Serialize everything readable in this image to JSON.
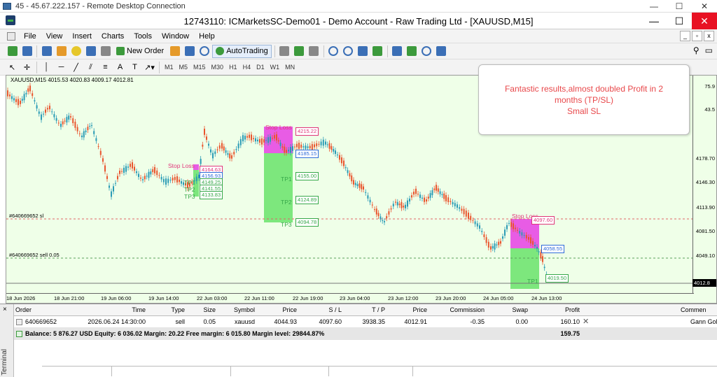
{
  "rdp": {
    "title": "45 - 45.67.222.157 - Remote Desktop Connection",
    "minimize": "—",
    "maximize": "☐",
    "close": "✕"
  },
  "window": {
    "title": "12743110: ICMarketsSC-Demo01 - Demo Account - Raw Trading Ltd - [XAUUSD,M15]",
    "minimize": "—",
    "maximize": "☐",
    "close": "✕"
  },
  "menu": {
    "items": [
      "File",
      "View",
      "Insert",
      "Charts",
      "Tools",
      "Window",
      "Help"
    ],
    "mdi": [
      "_",
      "▫",
      "x"
    ]
  },
  "toolbar": {
    "new_order": "New Order",
    "autotrading": "AutoTrading",
    "timeframes": [
      "M1",
      "M5",
      "M15",
      "M30",
      "H1",
      "H4",
      "D1",
      "W1",
      "MN"
    ]
  },
  "chart": {
    "info": "XAUUSD,M15  4015.53 4020.83 4009.17 4012.81",
    "price_ticks": [
      "75.9",
      "43.5",
      "4178.70",
      "4146.30",
      "4113.90",
      "4081.50",
      "4049.10"
    ],
    "current_price": "4012.8",
    "time_ticks": [
      "18 Jun 2026",
      "18 Jun 21:00",
      "19 Jun 06:00",
      "19 Jun 14:00",
      "22 Jun 03:00",
      "22 Jun 11:00",
      "22 Jun 19:00",
      "23 Jun 04:00",
      "23 Jun 12:00",
      "23 Jun 20:00",
      "24 Jun 05:00",
      "24 Jun 13:00"
    ],
    "order_line_sl": "#640669652 sl",
    "order_line_sell": "#640669652 sell 0.05",
    "colors": {
      "background": "#efffe8",
      "bull": "#2a9bb5",
      "bear": "#e9552e",
      "sl_zone": "#e85ce5",
      "tp_zone": "#7de77d"
    },
    "setups": [
      {
        "sl_label": "Stop Loss",
        "sl_price": "4164.63",
        "entry_price": "4156.93",
        "tp_labels": [
          "TP1",
          "TP2",
          "TP3"
        ],
        "tp_prices": [
          "4149.25",
          "4141.55",
          "4133.83"
        ]
      },
      {
        "sl_label": "Stop Loss",
        "sl_price": "4215.22",
        "entry_price": "4185.15",
        "tp_labels": [
          "TP1",
          "TP2",
          "TP3"
        ],
        "tp_prices": [
          "4155.00",
          "4124.89",
          "4094.78"
        ]
      },
      {
        "sl_label": "Stop Loss",
        "sl_price": "4097.60",
        "entry_price": "4058.55",
        "tp_labels": [
          "TP1"
        ],
        "tp_prices": [
          "4019.50"
        ]
      }
    ]
  },
  "note": {
    "line1": "Fantastic results,almost doubled Profit in 2",
    "line2": "months (TP/SL)",
    "line3": "Small SL"
  },
  "terminal": {
    "side_label": "Terminal",
    "close": "×",
    "headers": [
      "Order",
      "Time",
      "Type",
      "Size",
      "Symbol",
      "Price",
      "S / L",
      "T / P",
      "Price",
      "Commission",
      "Swap",
      "Profit",
      "Commen"
    ],
    "order": {
      "id": "640669652",
      "time": "2026.06.24 14:30:00",
      "type": "sell",
      "size": "0.05",
      "symbol": "xauusd",
      "open_price": "4044.93",
      "sl": "4097.60",
      "tp": "3938.35",
      "price": "4012.91",
      "commission": "-0.35",
      "swap": "0.00",
      "profit": "160.10",
      "close": "✕",
      "comment": "Gann Gol"
    },
    "balance_line": "Balance: 5 876.27 USD  Equity: 6 036.02  Margin: 20.22  Free margin: 6 015.80  Margin level: 29844.87%",
    "balance_total": "159.75"
  }
}
